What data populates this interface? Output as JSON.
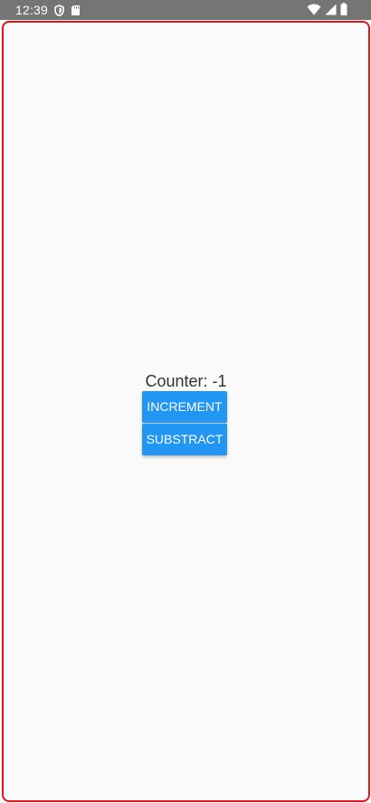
{
  "status_bar": {
    "time": "12:39",
    "icons": [
      "shield-icon",
      "sd-card-icon",
      "wifi-icon",
      "cell-signal-icon",
      "battery-icon"
    ]
  },
  "counter": {
    "label": "Counter: -1"
  },
  "buttons": {
    "increment": "INCREMENT",
    "subtract": "SUBSTRACT"
  },
  "colors": {
    "status_bar": "#757575",
    "frame_border": "#e81216",
    "button": "#2196f3",
    "background": "#fafafa"
  }
}
